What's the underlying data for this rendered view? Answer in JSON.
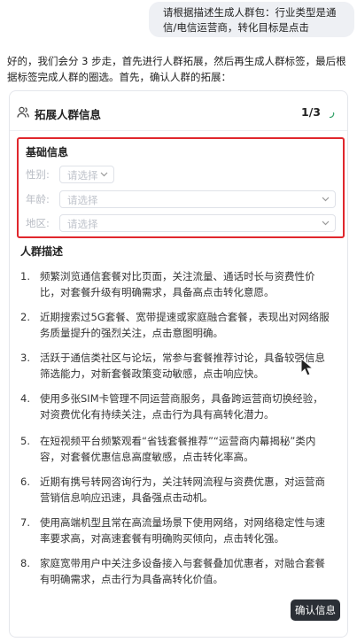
{
  "user_message": "请根据描述生成人群包：行业类型是通信/电信运营商，转化目标是点击",
  "assistant_message": "好的，我们会分 3 步走，首先进行人群拓展，然后再生成人群标签，最后根据标签完成人群的圈选。首先，确认人群的拓展：",
  "card": {
    "title": "拓展人群信息",
    "step": "1/3",
    "icon": "users-icon"
  },
  "basic_info": {
    "title": "基础信息",
    "fields": [
      {
        "label": "性别:",
        "placeholder": "请选择"
      },
      {
        "label": "年龄:",
        "placeholder": "请选择"
      },
      {
        "label": "地区:",
        "placeholder": "请选择"
      }
    ]
  },
  "description": {
    "title": "人群描述",
    "items": [
      {
        "num": "1.",
        "text": "频繁浏览通信套餐对比页面，关注流量、通话时长与资费性价比，对套餐升级有明确需求，具备高点击转化意愿。"
      },
      {
        "num": "2.",
        "text": "近期搜索过5G套餐、宽带提速或家庭融合套餐，表现出对网络服务质量提升的强烈关注，点击意图明确。"
      },
      {
        "num": "3.",
        "text": "活跃于通信类社区与论坛，常参与套餐推荐讨论，具备较强信息筛选能力，对新套餐政策变动敏感，点击响应快。"
      },
      {
        "num": "4.",
        "text": "使用多张SIM卡管理不同运营商服务，具备跨运营商切换经验，对资费优化有持续关注，点击行为具有高转化潜力。"
      },
      {
        "num": "5.",
        "text": "在短视频平台频繁观看“省钱套餐推荐”“运营商内幕揭秘”类内容，对套餐优惠信息高度敏感，点击转化率高。"
      },
      {
        "num": "6.",
        "text": "近期有携号转网咨询行为，关注转网流程与资费优惠，对运营商营销信息响应迅速，具备强点击动机。"
      },
      {
        "num": "7.",
        "text": "使用高端机型且常在高流量场景下使用网络，对网络稳定性与速率要求高，对高速套餐有明确购买倾向，点击转化强。"
      },
      {
        "num": "8.",
        "text": "家庭宽带用户中关注多设备接入与套餐叠加优惠者，对融合套餐有明确需求，点击行为具备高转化价值。"
      }
    ]
  },
  "confirm_button": "确认信息",
  "colors": {
    "highlight_border": "#e0272d",
    "button_bg": "#2b2f36",
    "bubble_bg": "#eef0f4"
  }
}
